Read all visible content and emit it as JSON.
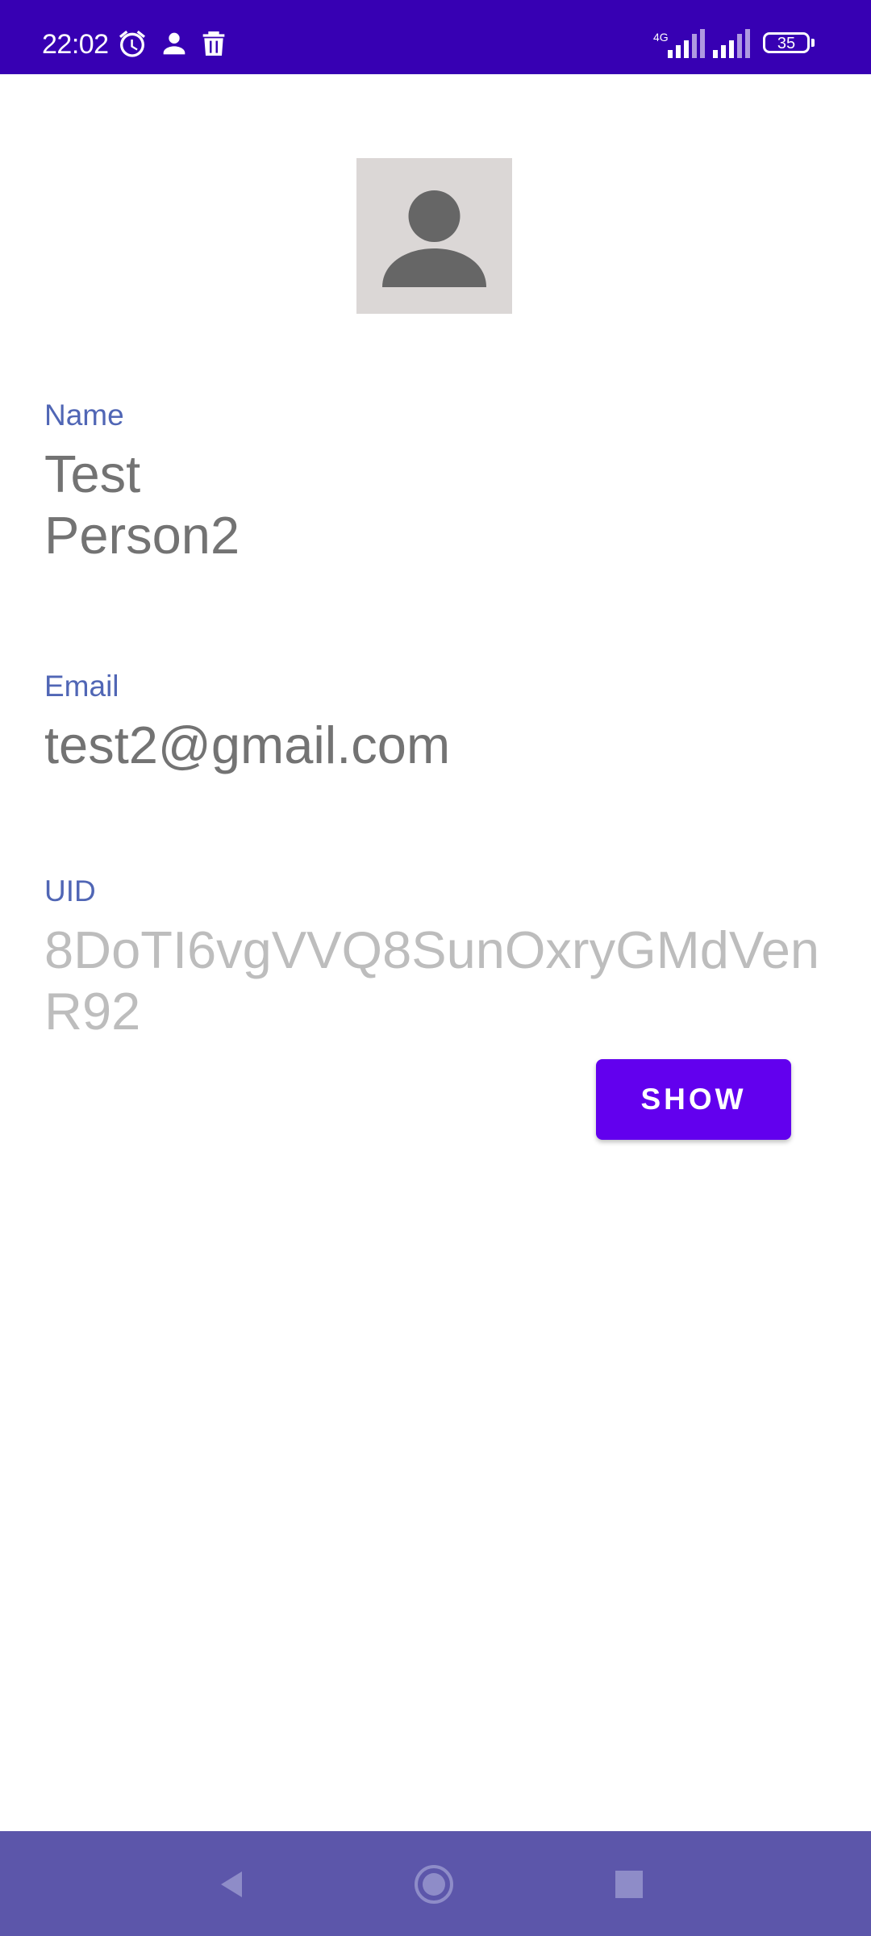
{
  "status_bar": {
    "time": "22:02",
    "battery": "35",
    "network": "4G",
    "icons": [
      "alarm-icon",
      "person-icon",
      "trash-icon",
      "signal-icon",
      "signal-icon",
      "battery-icon"
    ],
    "background": "#3700b3"
  },
  "profile": {
    "avatar_icon": "person-placeholder-icon",
    "name_label": "Name",
    "name_value": "Test Person2",
    "email_label": "Email",
    "email_value": "test2@gmail.com",
    "uid_label": "UID",
    "uid_value": "8DoTI6vgVVQ8SunOxryGMdVenR92",
    "show_button": "SHOW"
  },
  "colors": {
    "accent": "#6200ee",
    "label": "#5066b5",
    "value": "#737373",
    "uid_value": "#bdbdbd",
    "nav_bar": "#5c56aa"
  },
  "nav_bar": {
    "icons": [
      "back-icon",
      "home-icon",
      "recents-icon"
    ]
  }
}
